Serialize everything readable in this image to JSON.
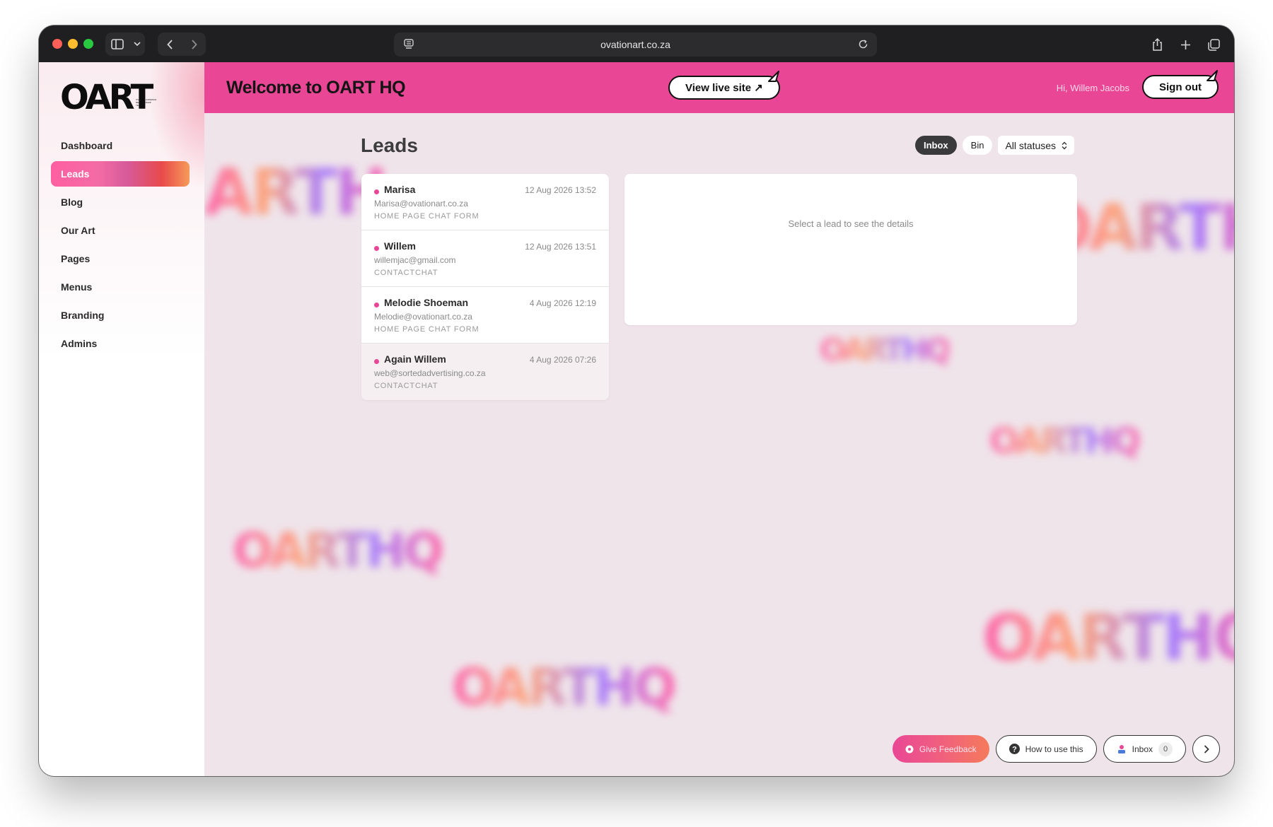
{
  "browser": {
    "url": "ovationart.co.za"
  },
  "sidebar": {
    "logo_text": "OART",
    "logo_tagline": "OVATION AUDIENCE RELATIONSHIP TEAM",
    "items": [
      {
        "label": "Dashboard",
        "active": false
      },
      {
        "label": "Leads",
        "active": true
      },
      {
        "label": "Blog",
        "active": false
      },
      {
        "label": "Our Art",
        "active": false
      },
      {
        "label": "Pages",
        "active": false
      },
      {
        "label": "Menus",
        "active": false
      },
      {
        "label": "Branding",
        "active": false
      },
      {
        "label": "Admins",
        "active": false
      }
    ]
  },
  "header": {
    "title": "Welcome to OART HQ",
    "view_live_label": "View live site ↗",
    "greeting": "Hi, Willem Jacobs",
    "sign_out_label": "Sign out"
  },
  "page": {
    "title": "Leads",
    "filters": {
      "inbox_label": "Inbox",
      "bin_label": "Bin",
      "status_select": "All statuses"
    }
  },
  "leads": [
    {
      "name": "Marisa",
      "date": "12 Aug 2026 13:52",
      "email": "Marisa@ovationart.co.za",
      "source": "HOME PAGE CHAT FORM"
    },
    {
      "name": "Willem",
      "date": "12 Aug 2026 13:51",
      "email": "willemjac@gmail.com",
      "source": "CONTACTCHAT"
    },
    {
      "name": "Melodie Shoeman",
      "date": "4 Aug 2026 12:19",
      "email": "Melodie@ovationart.co.za",
      "source": "HOME PAGE CHAT FORM"
    },
    {
      "name": "Again Willem",
      "date": "4 Aug 2026 07:26",
      "email": "web@sortedadvertising.co.za",
      "source": "CONTACTCHAT"
    }
  ],
  "detail": {
    "empty_text": "Select a lead to see the details"
  },
  "bottom_bar": {
    "feedback_label": "Give Feedback",
    "help_label": "How to use this",
    "inbox_label": "Inbox",
    "inbox_count": "0"
  },
  "colors": {
    "header": "#e94795",
    "background": "#efe4ea",
    "accent_dot": "#e94795"
  }
}
